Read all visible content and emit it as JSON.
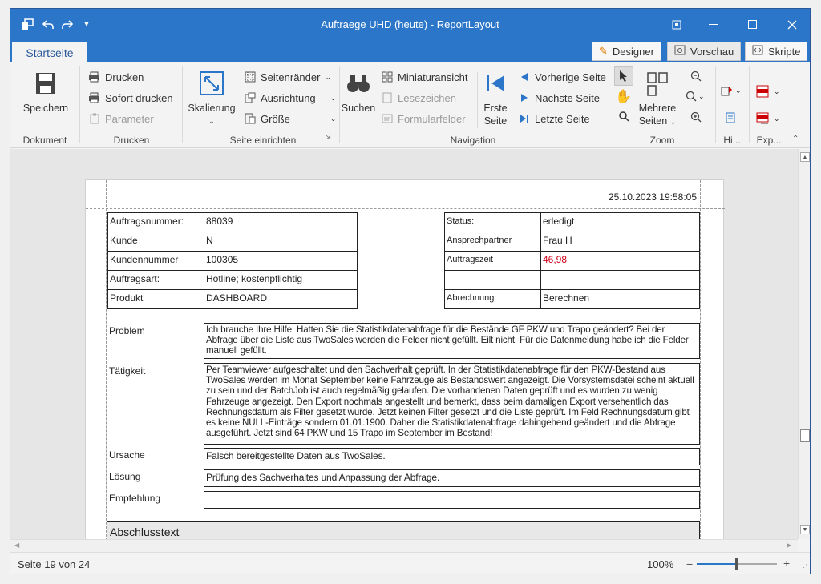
{
  "window": {
    "title": "Auftraege UHD  (heute) - ReportLayout"
  },
  "ribbon": {
    "active_tab": "Startseite",
    "right_tabs": [
      "Designer",
      "Vorschau",
      "Skripte"
    ],
    "dokument": {
      "save": "Speichern",
      "label": "Dokument"
    },
    "drucken": {
      "print": "Drucken",
      "print_now": "Sofort drucken",
      "params": "Parameter",
      "label": "Drucken"
    },
    "seite": {
      "scale": "Skalierung",
      "margins": "Seitenränder",
      "orientation": "Ausrichtung",
      "size": "Größe",
      "label": "Seite einrichten"
    },
    "navigation": {
      "search": "Suchen",
      "thumbnails": "Miniaturansicht",
      "bookmarks": "Lesezeichen",
      "formfields": "Formularfelder",
      "first_l1": "Erste",
      "first_l2": "Seite",
      "prev": "Vorherige Seite",
      "next": "Nächste Seite",
      "last": "Letzte Seite",
      "label": "Navigation"
    },
    "zoom": {
      "multi_l1": "Mehrere",
      "multi_l2": "Seiten",
      "label": "Zoom"
    },
    "hi_label": "Hi...",
    "exp_label": "Exp..."
  },
  "report": {
    "timestamp": "25.10.2023 19:58:05",
    "left_fields": [
      {
        "label": "Auftragsnummer:",
        "value": "88039"
      },
      {
        "label": "Kunde",
        "value": "N"
      },
      {
        "label": "Kundennummer",
        "value": "100305"
      },
      {
        "label": "Auftragsart:",
        "value": "Hotline; kostenpflichtig"
      },
      {
        "label": "Produkt",
        "value": "DASHBOARD"
      }
    ],
    "right_fields": [
      {
        "label": "Status:",
        "value": "erledigt"
      },
      {
        "label": "Ansprechpartner",
        "value": "Frau H"
      },
      {
        "label": "Auftragszeit",
        "value": "46,98"
      },
      {
        "label": "",
        "value": ""
      },
      {
        "label": "Abrechnung:",
        "value": "Berechnen"
      }
    ],
    "problem_label": "Problem",
    "problem_text": "Ich brauche Ihre Hilfe: Hatten Sie die Statistikdatenabfrage für die Bestände GF PKW und Trapo geändert? Bei der Abfrage über die Liste aus TwoSales werden die Felder nicht gefüllt. Eilt nicht. Für die Datenmeldung habe ich die Felder manuell gefüllt.",
    "taetigkeit_label": "Tätigkeit",
    "taetigkeit_text": "Per Teamviewer aufgeschaltet und den Sachverhalt geprüft. In der Statistikdatenabfrage für den PKW-Bestand aus TwoSales werden im Monat September keine Fahrzeuge als Bestandswert angezeigt. Die Vorsystemsdatei scheint aktuell zu sein und der BatchJob ist auch regelmäßig gelaufen. Die vorhandenen Daten geprüft und es wurden zu wenig Fahrzeuge angezeigt. Den Export nochmals angestellt und bemerkt, dass beim damaligen Export versehentlich das Rechnungsdatum als Filter gesetzt wurde. Jetzt keinen Filter gesetzt und die Liste geprüft. Im Feld Rechnungsdatum gibt es keine NULL-Einträge sondern 01.01.1900. Daher die Statistikdatenabfrage dahingehend geändert und die Abfrage ausgeführt. Jetzt sind 64 PKW und 15 Trapo im September im Bestand!",
    "ursache_label": "Ursache",
    "ursache_text": "Falsch bereitgestellte Daten aus TwoSales.",
    "loesung_label": "Lösung",
    "loesung_text": "Prüfung des Sachverhaltes und Anpassung der Abfrage.",
    "empfehlung_label": "Empfehlung",
    "empfehlung_text": "",
    "abschluss_label": "Abschlusstext"
  },
  "status": {
    "page": "Seite 19 von 24",
    "zoom": "100%",
    "zoom_level": 0.5
  },
  "colors": {
    "titlebar": "#2b76c8",
    "highlight_value": "#d0021b"
  }
}
